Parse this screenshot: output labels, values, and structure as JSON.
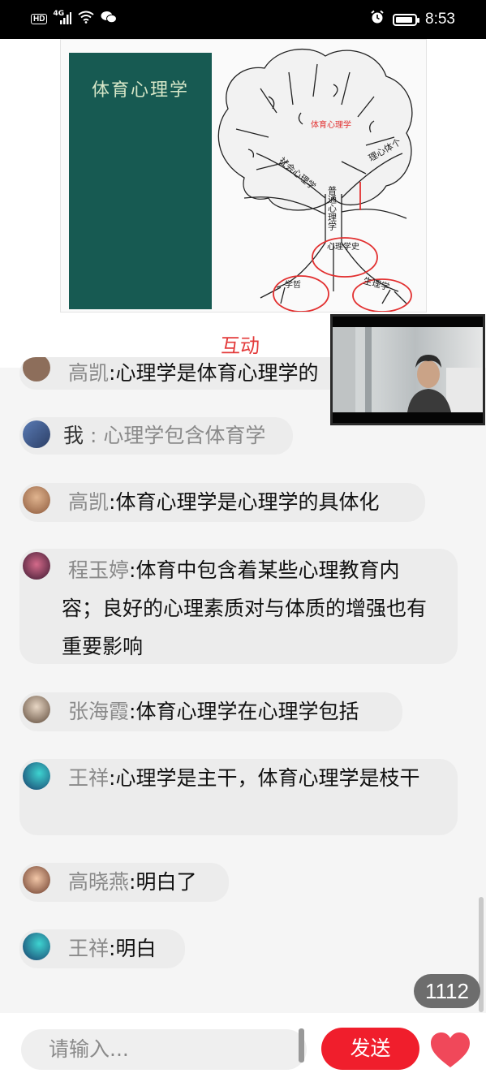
{
  "status_bar": {
    "hd_label": "HD",
    "network_label": "4G",
    "time": "8:53",
    "battery_percent": 90
  },
  "slide": {
    "book_title": "体育心理学",
    "tree_labels": {
      "crown": "体育心理学",
      "left_branch": "社会心理学",
      "right_branch": "理心体个",
      "trunk": "普通心理学",
      "root_center": "心理学史",
      "root_left": "学哲",
      "root_right": "生理学"
    }
  },
  "section_tab": "互动",
  "messages": [
    {
      "name": "高凯",
      "sep": ":",
      "text": "心理学是体育心理学的",
      "avatar": "teal-dog"
    },
    {
      "name": "我",
      "sep": " : ",
      "text": "心理学包含体育学",
      "avatar": "blue-person",
      "is_self": true
    },
    {
      "name": "高凯",
      "sep": ":",
      "text": "体育心理学是心理学的具体化",
      "avatar": "teal-dog"
    },
    {
      "name": "程玉婷",
      "sep": ":",
      "text": "体育中包含着某些心理教育内容；良好的心理素质对与体质的增强也有重要影响",
      "avatar": "dark-girl"
    },
    {
      "name": "张海霞",
      "sep": ":",
      "text": "体育心理学在心理学包括",
      "avatar": "light-girl"
    },
    {
      "name": "王祥",
      "sep": ":",
      "text": "心理学是主干，体育心理学是枝干",
      "avatar": "cyan-figure"
    },
    {
      "name": "高晓燕",
      "sep": ":",
      "text": "明白了",
      "avatar": "cartoon-girl"
    },
    {
      "name": "王祥",
      "sep": ":",
      "text": "明白",
      "avatar": "cyan-figure"
    }
  ],
  "online_count": "1112",
  "input": {
    "placeholder": "请输入..."
  },
  "send_label": "发送",
  "colors": {
    "accent": "#f01e2c",
    "tab_accent": "#e33a3a",
    "book": "#175a52"
  }
}
